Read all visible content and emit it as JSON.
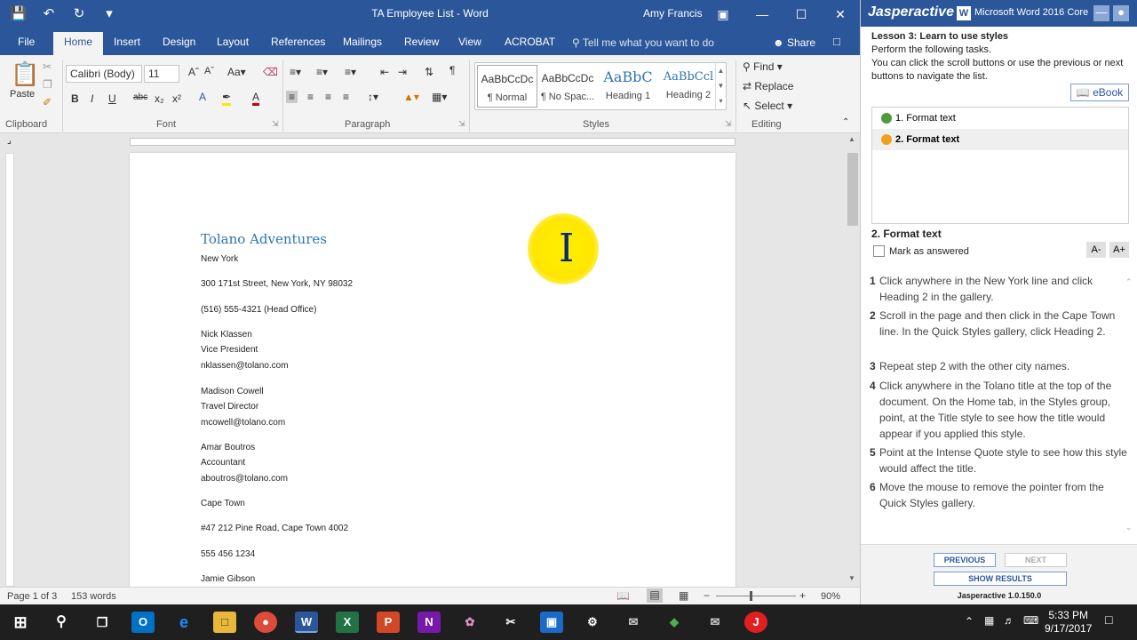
{
  "word": {
    "title": "TA Employee List  -  Word",
    "user": "Amy Francis",
    "tabs": [
      "File",
      "Home",
      "Insert",
      "Design",
      "Layout",
      "References",
      "Mailings",
      "Review",
      "View",
      "ACROBAT"
    ],
    "tell_me": "Tell me what you want to do",
    "share": "Share",
    "ribbon": {
      "paste": "Paste",
      "font_name": "Calibri (Body)",
      "font_size": "11",
      "styles": [
        {
          "preview": "AaBbCcDc",
          "name": "¶ Normal"
        },
        {
          "preview": "AaBbCcDc",
          "name": "¶ No Spac..."
        },
        {
          "preview": "AaBbC",
          "name": "Heading 1"
        },
        {
          "preview": "AaBbCcl",
          "name": "Heading 2"
        }
      ],
      "find": "Find",
      "replace": "Replace",
      "select": "Select",
      "groups": [
        "Clipboard",
        "Font",
        "Paragraph",
        "Styles",
        "Editing"
      ]
    },
    "document": {
      "title": "Tolano Adventures",
      "lines": [
        "New York",
        "300 171st Street, New York, NY 98032",
        "(516) 555-4321 (Head Office)",
        "Nick Klassen",
        "Vice President",
        "nklassen@tolano.com",
        "Madison Cowell",
        "Travel Director",
        "mcowell@tolano.com",
        "Amar Boutros",
        "Accountant",
        "aboutros@tolano.com",
        "Cape Town",
        "#47 212 Pine Road, Cape Town  4002",
        "555 456 1234",
        "Jamie Gibson"
      ]
    },
    "status": {
      "page": "Page 1 of 3",
      "words": "153 words",
      "zoom": "90%"
    }
  },
  "panel": {
    "brand": "Jasperactive",
    "product": "Microsoft Word 2016 Core",
    "lesson_title": "Lesson 3: Learn to use styles",
    "intro": [
      "Perform the following tasks.",
      "You can click the scroll buttons or use the previous or next",
      "buttons to navigate the list."
    ],
    "ebook": "eBook",
    "tasks": [
      "1. Format text",
      "2. Format text"
    ],
    "current_task": "2. Format text",
    "mark_answered": "Mark as answered",
    "font_down": "A-",
    "font_up": "A+",
    "steps": [
      {
        "num": "1",
        "text": "Click anywhere in the New York line and click Heading 2 in the gallery."
      },
      {
        "num": "2",
        "text": "Scroll in the page and then click in the Cape Town line. In the Quick Styles gallery, click Heading 2."
      },
      {
        "num": "3",
        "text": "Repeat step 2 with the other city names."
      },
      {
        "num": "4",
        "text": "Click anywhere in the Tolano title at the top of the document. On the Home tab, in the Styles group, point, at the Title style to see how the title would appear if you applied this style."
      },
      {
        "num": "5",
        "text": "Point at the Intense Quote style to see how this style would affect the title."
      },
      {
        "num": "6",
        "text": "Move the mouse to remove the pointer from the Quick Styles gallery."
      }
    ],
    "previous": "PREVIOUS",
    "next": "NEXT",
    "show_results": "SHOW RESULTS",
    "version": "Jasperactive 1.0.150.0"
  },
  "taskbar": {
    "time": "5:33 PM",
    "date": "9/17/2017"
  }
}
